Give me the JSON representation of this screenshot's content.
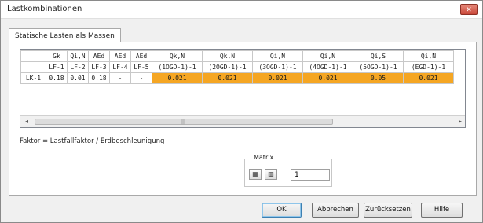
{
  "window": {
    "title": "Lastkombinationen",
    "close_label": "✕"
  },
  "tab": {
    "label": "Statische Lasten als Massen"
  },
  "grid": {
    "top_headers": [
      "Gk",
      "Qi,N",
      "AEd",
      "AEd",
      "AEd",
      "Qk,N",
      "Qk,N",
      "Qi,N",
      "Qi,N",
      "Qi,S",
      "Qi,N"
    ],
    "sub_headers": [
      "LF-1",
      "LF-2",
      "LF-3",
      "LF-4",
      "LF-5",
      "(1OGD-1)-1",
      "(2OGD-1)-1",
      "(3OGD-1)-1",
      "(4OGD-1)-1",
      "(5OGD-1)-1",
      "(EGD-1)-1"
    ],
    "rows": [
      {
        "label": "LK-1",
        "values": [
          "0.18",
          "0.01",
          "0.18",
          "-",
          "-",
          "0.021",
          "0.021",
          "0.021",
          "0.021",
          "0.05",
          "0.021"
        ]
      }
    ],
    "highlight_color": "#f5a623"
  },
  "scrollbar": {
    "left_arrow": "◂",
    "right_arrow": "▸",
    "grip": "|||"
  },
  "footnote": "Faktor = Lastfallfaktor / Erdbeschleunigung",
  "matrix": {
    "label": "Matrix",
    "value": "1"
  },
  "buttons": {
    "ok": "OK",
    "cancel": "Abbrechen",
    "reset": "Zurücksetzen",
    "help": "Hilfe"
  }
}
